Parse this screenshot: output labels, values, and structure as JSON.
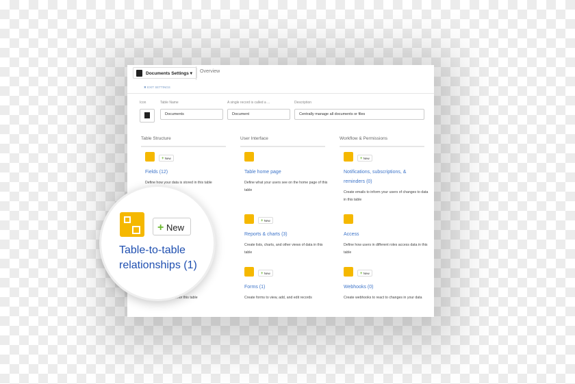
{
  "header": {
    "table_menu": "Documents Settings",
    "breadcrumb": "Overview",
    "exit": "✖ EXIT SETTINGS"
  },
  "form": {
    "icon_label": "Icon",
    "name_label": "Table Name",
    "name_value": "Documents",
    "record_label": "A single record is called a ...",
    "record_value": "Document",
    "desc_label": "Description",
    "desc_value": "Centrally manage all documents or files"
  },
  "new_label": "New",
  "sections": [
    {
      "title": "Table Structure",
      "items": [
        {
          "title": "Fields (12)",
          "desc": "Define how your data is stored in this table"
        },
        {
          "title": "Table-to-table relationships (1)",
          "desc": "...for this table"
        }
      ]
    },
    {
      "title": "User Interface",
      "items": [
        {
          "title": "Table home page",
          "desc": "Define what your users see on the home page of this table"
        },
        {
          "title": "Reports & charts (3)",
          "desc": "Create lists, charts, and other views of data in this table"
        },
        {
          "title": "Forms (1)",
          "desc": "Create forms to view, add, and edit records"
        }
      ]
    },
    {
      "title": "Workflow & Permissions",
      "items": [
        {
          "title": "Notifications, subscriptions, & reminders (0)",
          "desc": "Create emails to inform your users of changes to data in this table"
        },
        {
          "title": "Access",
          "desc": "Define how users in different roles access data in this table"
        },
        {
          "title": "Webhooks (0)",
          "desc": "Create webhooks to react to changes in your data"
        }
      ]
    }
  ],
  "colors": {
    "accent": "#f5b800",
    "link": "#3d74c9",
    "plus": "#6ab82c"
  }
}
